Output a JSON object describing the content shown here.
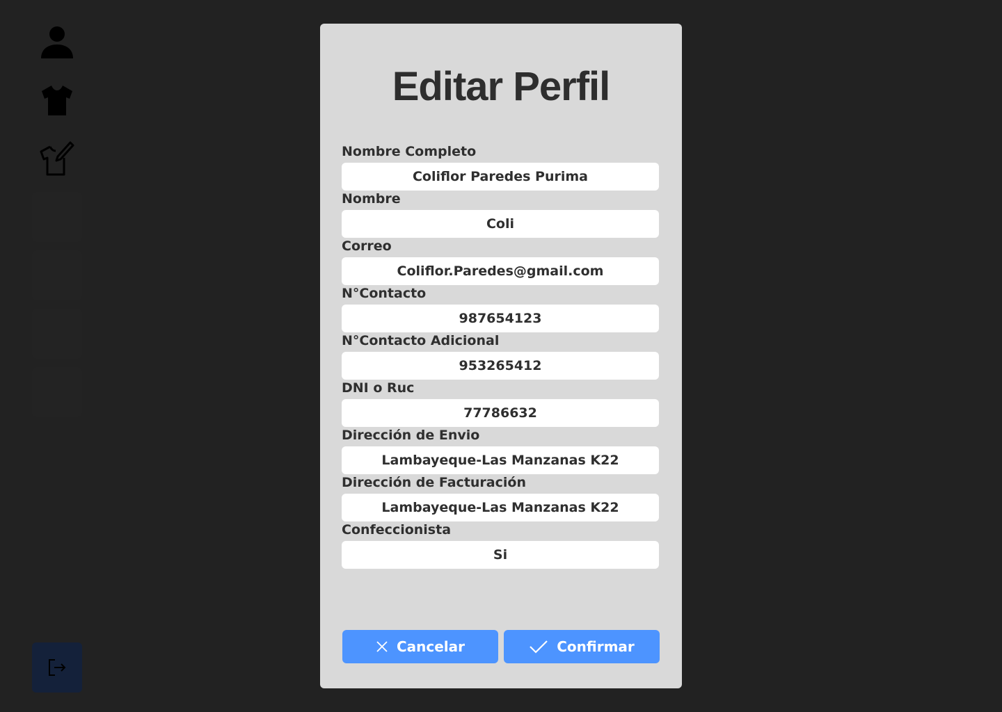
{
  "sidebar": {
    "items": [
      {
        "icon": "user-icon"
      },
      {
        "icon": "shirt-icon"
      },
      {
        "icon": "shirt-edit-icon"
      }
    ],
    "logout_icon": "logout-icon"
  },
  "modal": {
    "title": "Editar Perfil",
    "fields": [
      {
        "label": "Nombre Completo",
        "value": "Coliflor Paredes Purima"
      },
      {
        "label": "Nombre",
        "value": "Coli"
      },
      {
        "label": "Correo",
        "value": "Coliflor.Paredes@gmail.com"
      },
      {
        "label": "N°Contacto",
        "value": "987654123"
      },
      {
        "label": "N°Contacto Adicional",
        "value": "953265412"
      },
      {
        "label": "DNI o Ruc",
        "value": "77786632"
      },
      {
        "label": "Dirección de Envio",
        "value": "Lambayeque-Las Manzanas K22"
      },
      {
        "label": "Dirección de Facturación",
        "value": "Lambayeque-Las Manzanas K22"
      },
      {
        "label": "Confeccionista",
        "value": "Si"
      }
    ],
    "cancel_label": "Cancelar",
    "confirm_label": "Confirmar"
  },
  "colors": {
    "background": "#222222",
    "modal": "#d9d9d9",
    "accent": "#4d94ff",
    "text": "#2f2f2f"
  }
}
